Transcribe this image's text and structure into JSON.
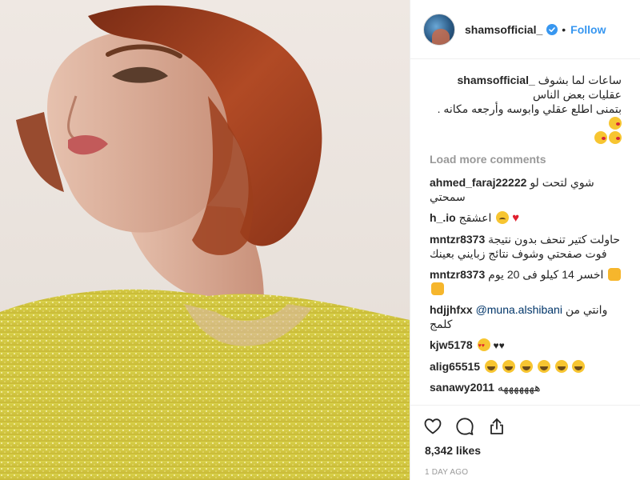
{
  "post": {
    "author": {
      "username": "shamsofficial_",
      "follow_label": "Follow",
      "separator": "•"
    },
    "photo_description": "portrait",
    "caption": {
      "username": "shamsofficial_",
      "text": "ساعات لما بشوف عقليات بعض الناس",
      "text_line2": "بتمنى اطلع عقلي وابوسه وأرجعه مكانه ."
    },
    "load_more_label": "Load more comments",
    "comments": [
      {
        "username": "ahmed_faraj22222",
        "text": "شوي لتحت لو سمحتي"
      },
      {
        "username": "h_.io",
        "text": "اعشقج"
      },
      {
        "username": "mntzr8373",
        "text": "حاولت كتير تنحف بدون نتيجة فوت صفحتي وشوف نتائج زبايني بعينك"
      },
      {
        "username": "mntzr8373",
        "text": "اخسر 14 كيلو فى 20 يوم"
      },
      {
        "username": "hdjjhfxx",
        "mention": "@muna.alshibani",
        "text": "وانتي من كلمج"
      },
      {
        "username": "kjw5178",
        "text": "♥♥"
      },
      {
        "username": "alig65515",
        "text": ""
      },
      {
        "username": "sanawy2011",
        "text": "هههههههه"
      }
    ],
    "likes": "8,342 likes",
    "time": "1 DAY AGO",
    "icons": {
      "like": "heart-outline-icon",
      "comment": "comment-bubble-icon",
      "share": "share-icon",
      "verified": "verified-badge-icon"
    },
    "colors": {
      "follow": "#3897f0",
      "muted": "#999999",
      "text": "#262626",
      "hair": "#a23e1e",
      "dress": "#d9d24a"
    }
  }
}
